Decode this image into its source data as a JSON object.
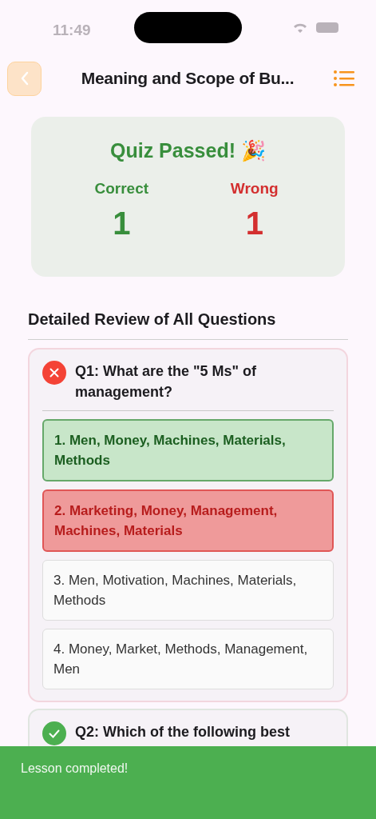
{
  "status_bar": {
    "time": "11:49"
  },
  "header": {
    "title": "Meaning and Scope of Bu..."
  },
  "summary": {
    "title": "Quiz Passed! 🎉",
    "correct_label": "Correct",
    "correct_count": "1",
    "wrong_label": "Wrong",
    "wrong_count": "1"
  },
  "review": {
    "heading": "Detailed Review of All Questions",
    "questions": [
      {
        "text": "Q1: What are the \"5 Ms\" of management?",
        "answered_correctly": false,
        "options": [
          {
            "text": "1. Men, Money, Machines, Materials, Methods",
            "correct": true,
            "selected": false
          },
          {
            "text": "2. Marketing, Money, Management, Machines, Materials",
            "correct": false,
            "selected": true
          },
          {
            "text": "3. Men, Motivation, Machines, Materials, Methods",
            "correct": false,
            "selected": false
          },
          {
            "text": "4. Money, Market, Methods, Management, Men",
            "correct": false,
            "selected": false
          }
        ]
      },
      {
        "text": "Q2: Which of the following best",
        "answered_correctly": true
      }
    ]
  },
  "toast": {
    "message": "Lesson completed!"
  }
}
